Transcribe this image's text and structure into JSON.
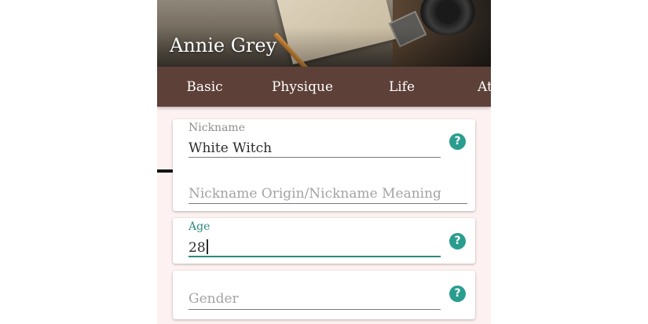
{
  "header": {
    "title": "Annie Grey"
  },
  "tabs": [
    {
      "label": "Basic",
      "active": true
    },
    {
      "label": "Physique"
    },
    {
      "label": "Life"
    },
    {
      "label": "At"
    }
  ],
  "form": {
    "nickname": {
      "label": "Nickname",
      "value": "White Witch"
    },
    "nickname_origin": {
      "placeholder": "Nickname Origin/Nickname Meaning"
    },
    "age": {
      "label": "Age",
      "value": "28"
    },
    "gender": {
      "placeholder": "Gender"
    },
    "help_glyph": "?"
  },
  "colors": {
    "tab_bar": "#5d4038",
    "accent": "#2a8a7c",
    "help_badge": "#2a9d8f",
    "background": "#fdf2f1"
  }
}
